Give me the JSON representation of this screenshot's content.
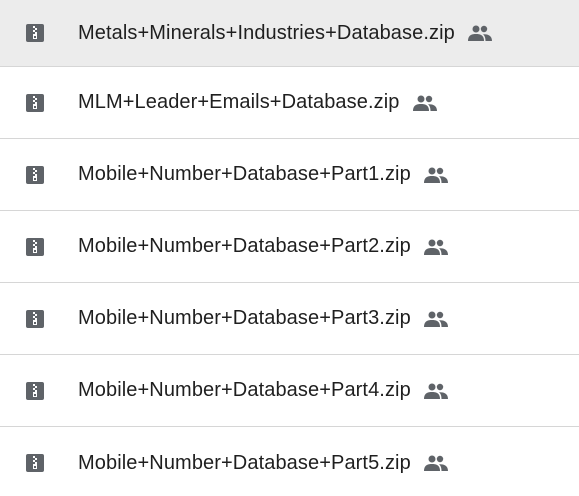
{
  "files": [
    {
      "name": "Metals+Minerals+Industries+Database.zip",
      "type_icon": "zip-file-icon",
      "shared_icon": "shared-people-icon",
      "selected": true
    },
    {
      "name": "MLM+Leader+Emails+Database.zip",
      "type_icon": "zip-file-icon",
      "shared_icon": "shared-people-icon",
      "selected": false
    },
    {
      "name": "Mobile+Number+Database+Part1.zip",
      "type_icon": "zip-file-icon",
      "shared_icon": "shared-people-icon",
      "selected": false
    },
    {
      "name": "Mobile+Number+Database+Part2.zip",
      "type_icon": "zip-file-icon",
      "shared_icon": "shared-people-icon",
      "selected": false
    },
    {
      "name": "Mobile+Number+Database+Part3.zip",
      "type_icon": "zip-file-icon",
      "shared_icon": "shared-people-icon",
      "selected": false
    },
    {
      "name": "Mobile+Number+Database+Part4.zip",
      "type_icon": "zip-file-icon",
      "shared_icon": "shared-people-icon",
      "selected": false
    },
    {
      "name": "Mobile+Number+Database+Part5.zip",
      "type_icon": "zip-file-icon",
      "shared_icon": "shared-people-icon",
      "selected": false
    }
  ],
  "colors": {
    "selected_row_bg": "#ececec",
    "icon_color": "#5f6368",
    "divider": "#d6d6d6",
    "text": "#1f1f1f"
  }
}
